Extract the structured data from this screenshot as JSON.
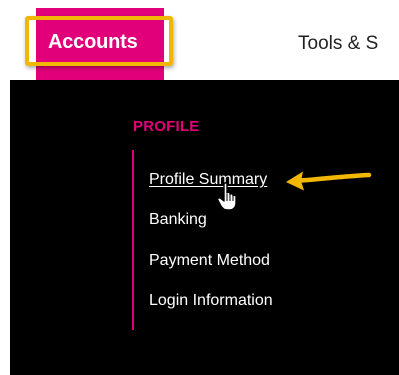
{
  "nav": {
    "accounts_label": "Accounts",
    "tools_label": "Tools & S"
  },
  "menu": {
    "section_heading": "PROFILE",
    "items": [
      {
        "label": "Profile Summary",
        "active": true
      },
      {
        "label": "Banking"
      },
      {
        "label": "Payment Method"
      },
      {
        "label": "Login Information"
      }
    ]
  },
  "colors": {
    "brand": "#e2007a",
    "highlight": "#f2b705",
    "panel": "#000000"
  },
  "icons": {
    "cursor": "hand-pointer-icon",
    "callout": "arrow-left-icon"
  }
}
